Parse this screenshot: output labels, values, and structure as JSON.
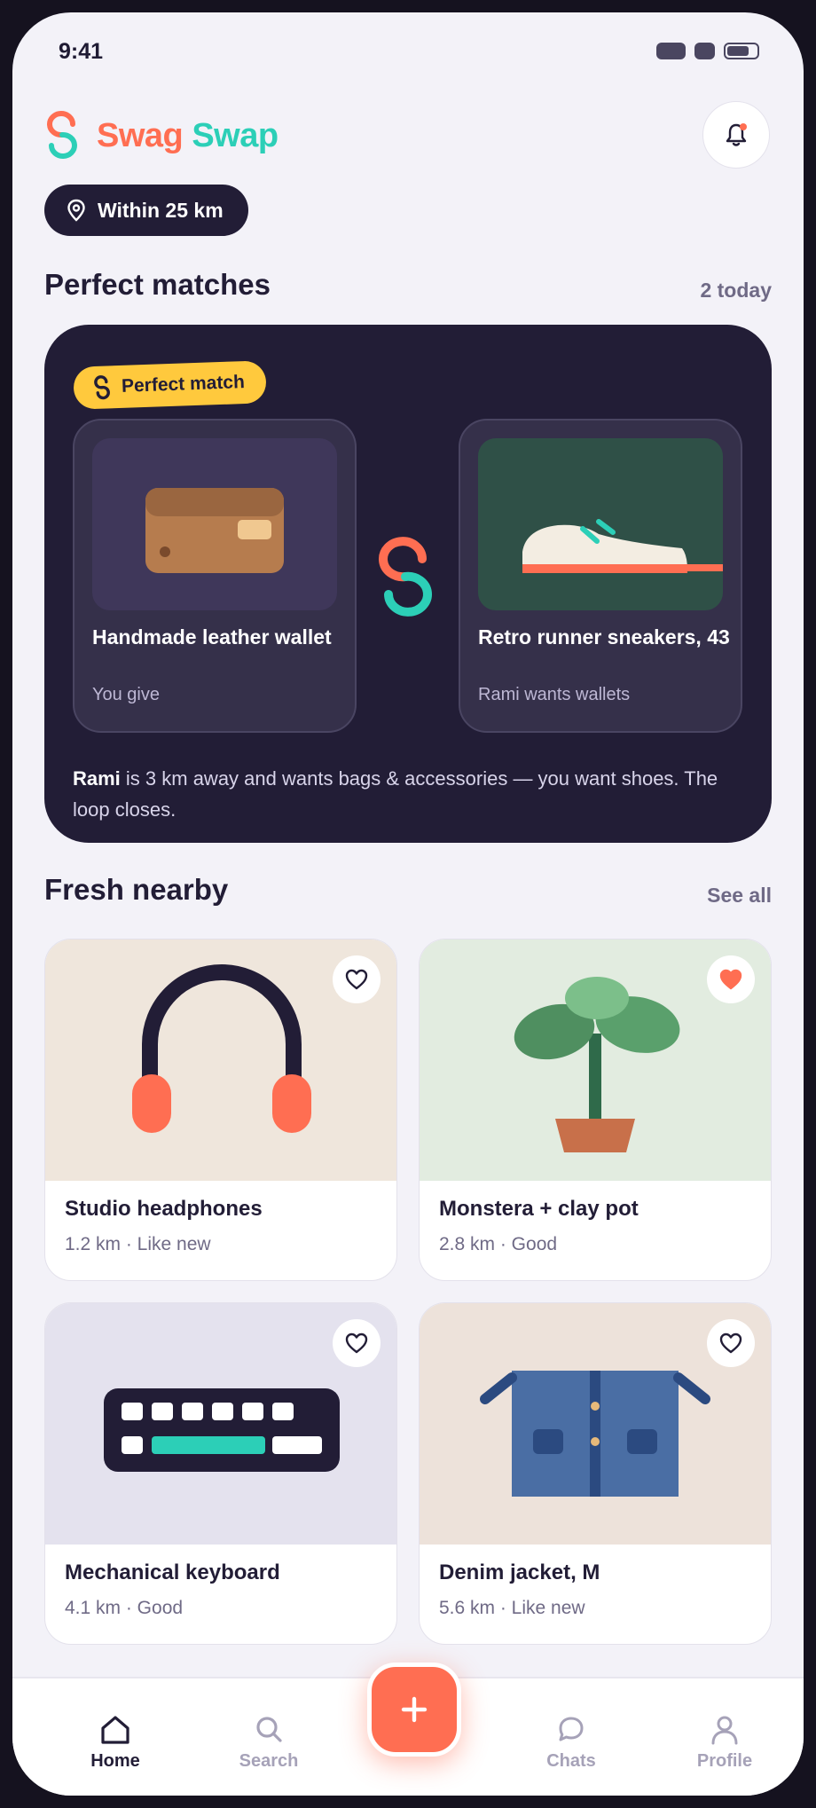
{
  "status": {
    "time": "9:41"
  },
  "app": {
    "name_part1": "Swag",
    "name_part2": "Swap"
  },
  "filter_chip": {
    "label": "Within 25 km"
  },
  "perfect_matches": {
    "title": "Perfect matches",
    "count_label": "2 today",
    "badge": "Perfect match",
    "give": {
      "title": "Handmade leather wallet",
      "subtitle": "You give"
    },
    "get": {
      "title": "Retro runner sneakers, 43",
      "subtitle": "Rami wants wallets"
    },
    "description_name": "Rami",
    "description_rest": " is 3 km away and wants bags & accessories — you want shoes. The loop closes."
  },
  "fresh_nearby": {
    "title": "Fresh nearby",
    "see_all": "See all",
    "items": [
      {
        "title": "Studio headphones",
        "meta": "1.2 km · Like new",
        "favorited": false
      },
      {
        "title": "Monstera + clay pot",
        "meta": "2.8 km · Good",
        "favorited": true
      },
      {
        "title": "Mechanical keyboard",
        "meta": "4.1 km · Good",
        "favorited": false
      },
      {
        "title": "Denim jacket, M",
        "meta": "5.6 km · Like new",
        "favorited": false
      }
    ]
  },
  "nav": {
    "home": "Home",
    "search": "Search",
    "chats": "Chats",
    "profile": "Profile",
    "active": "Home"
  },
  "colors": {
    "coral": "#ff6e52",
    "teal": "#2ccfb7",
    "navy": "#221d36",
    "yellow": "#ffc93d"
  }
}
